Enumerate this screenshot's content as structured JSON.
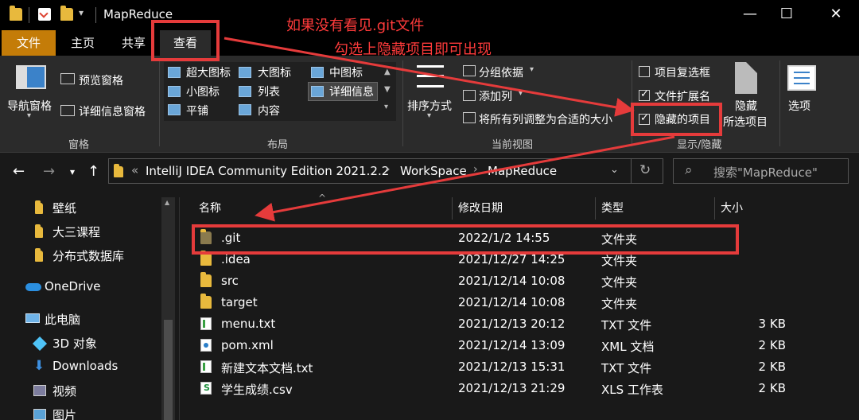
{
  "window": {
    "title": "MapReduce",
    "minimize": "—",
    "maximize": "☐",
    "close": "✕"
  },
  "tabs": [
    {
      "label": "文件"
    },
    {
      "label": "主页"
    },
    {
      "label": "共享"
    },
    {
      "label": "查看"
    }
  ],
  "ribbon": {
    "panes": {
      "nav_pane": "导航窗格",
      "preview_pane": "预览窗格",
      "details_pane": "详细信息窗格",
      "group": "窗格"
    },
    "layout": {
      "items": [
        "超大图标",
        "大图标",
        "中图标",
        "小图标",
        "列表",
        "详细信息",
        "平铺",
        "内容"
      ],
      "group": "布局"
    },
    "current_view": {
      "sort": "排序方式",
      "group_by": "分组依据",
      "add_column": "添加列",
      "fit_columns": "将所有列调整为合适的大小",
      "group": "当前视图"
    },
    "show_hide": {
      "item_checkbox": "项目复选框",
      "file_ext": "文件扩展名",
      "hidden_items": "隐藏的项目",
      "hide_selected_1": "隐藏",
      "hide_selected_2": "所选项目",
      "options": "选项",
      "group": "显示/隐藏"
    }
  },
  "address": {
    "prefix": "«",
    "crumbs": [
      "IntelliJ IDEA Community Edition 2021.2.2",
      "WorkSpace",
      "MapReduce"
    ],
    "search_placeholder": "搜索\"MapReduce\""
  },
  "nav": {
    "items": [
      {
        "label": "壁纸",
        "icon": "folder-icon"
      },
      {
        "label": "大三课程",
        "icon": "folder-icon"
      },
      {
        "label": "分布式数据库",
        "icon": "folder-icon"
      },
      {
        "label": "OneDrive",
        "icon": "cloud-icon"
      },
      {
        "label": "此电脑",
        "icon": "computer-icon"
      },
      {
        "label": "3D 对象",
        "icon": "cube-icon"
      },
      {
        "label": "Downloads",
        "icon": "download-icon"
      },
      {
        "label": "视频",
        "icon": "video-icon"
      },
      {
        "label": "图片",
        "icon": "picture-icon"
      }
    ]
  },
  "list": {
    "columns": [
      "名称",
      "修改日期",
      "类型",
      "大小"
    ],
    "rows": [
      {
        "name": ".git",
        "date": "2022/1/2 14:55",
        "type": "文件夹",
        "size": "",
        "icon": "folder-icon"
      },
      {
        "name": ".idea",
        "date": "2021/12/27 14:25",
        "type": "文件夹",
        "size": "",
        "icon": "folder-icon"
      },
      {
        "name": "src",
        "date": "2021/12/14 10:08",
        "type": "文件夹",
        "size": "",
        "icon": "folder-icon"
      },
      {
        "name": "target",
        "date": "2021/12/14 10:08",
        "type": "文件夹",
        "size": "",
        "icon": "folder-icon"
      },
      {
        "name": "menu.txt",
        "date": "2021/12/13 20:12",
        "type": "TXT 文件",
        "size": "3 KB",
        "icon": "txt-file-icon"
      },
      {
        "name": "pom.xml",
        "date": "2021/12/14 13:09",
        "type": "XML 文档",
        "size": "2 KB",
        "icon": "xml-file-icon"
      },
      {
        "name": "新建文本文档.txt",
        "date": "2021/12/13 15:31",
        "type": "TXT 文件",
        "size": "2 KB",
        "icon": "txt-file-icon"
      },
      {
        "name": "学生成绩.csv",
        "date": "2021/12/13 21:29",
        "type": "XLS 工作表",
        "size": "2 KB",
        "icon": "xls-file-icon"
      }
    ]
  },
  "annotation": {
    "line1": "如果没有看见.git文件",
    "line2": "勾选上隐藏项目即可出现",
    "color": "#e53b3b"
  }
}
